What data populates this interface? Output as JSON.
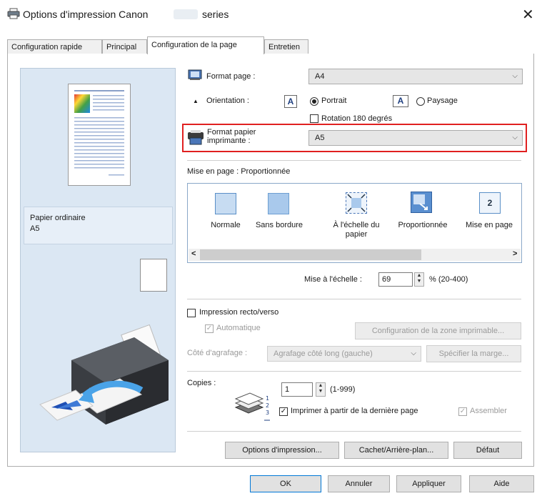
{
  "window": {
    "title": "Options d'impression Canon",
    "model_hidden": "      ",
    "title_suffix": "series",
    "close_glyph": "✕"
  },
  "tabs": [
    {
      "label": "Configuration rapide"
    },
    {
      "label": "Principal"
    },
    {
      "label": "Configuration de la page",
      "active": true
    },
    {
      "label": "Entretien"
    }
  ],
  "preview": {
    "paper_type": "Papier ordinaire",
    "paper_size": "A5"
  },
  "page_size": {
    "label": "Format page :",
    "value": "A4",
    "caret": "⌵"
  },
  "orientation": {
    "label": "Orientation :",
    "portrait": "Portrait",
    "landscape": "Paysage",
    "selected": "portrait",
    "portrait_icon": "A",
    "landscape_icon": "A"
  },
  "rotate180": {
    "label": "Rotation 180 degrés",
    "checked": false
  },
  "printer_paper": {
    "label_line1": "Format papier",
    "label_line2": "imprimante :",
    "value": "A5",
    "caret": "⌵",
    "highlight_color": "#e02020"
  },
  "layout": {
    "heading": "Mise en page :  Proportionnée",
    "items": [
      {
        "label": "Normale",
        "icon": "normal-layout-icon"
      },
      {
        "label": "Sans bordure",
        "icon": "borderless-layout-icon"
      },
      {
        "label_line1": "À l'échelle du",
        "label_line2": "papier",
        "icon": "fit-to-paper-icon"
      },
      {
        "label": "Proportionnée",
        "icon": "scaled-layout-icon",
        "selected": true
      },
      {
        "label": "Mise en page",
        "icon": "page-layout-icon",
        "badge": "2"
      }
    ],
    "scroll_left": "<",
    "scroll_right": ">"
  },
  "scaling": {
    "label": "Mise à l'échelle :",
    "value": "69",
    "range": "% (20-400)"
  },
  "duplex": {
    "label": "Impression recto/verso",
    "checked": false,
    "automatic_label": "Automatique",
    "automatic_checked": true,
    "print_area_button": "Configuration de la zone imprimable...",
    "stapling_label": "Côté d'agrafage :",
    "stapling_value": "Agrafage côté long (gauche)",
    "margin_button": "Spécifier la marge..."
  },
  "copies": {
    "label": "Copies :",
    "value": "1",
    "range": "(1-999)",
    "reverse_label": "Imprimer à partir de la dernière page",
    "reverse_checked": true,
    "collate_label": "Assembler",
    "collate_checked": true
  },
  "bottom_buttons": {
    "print_options": "Options d'impression...",
    "stamp": "Cachet/Arrière-plan...",
    "defaults": "Défaut"
  },
  "dialog_buttons": {
    "ok": "OK",
    "cancel": "Annuler",
    "apply": "Appliquer",
    "help": "Aide"
  }
}
